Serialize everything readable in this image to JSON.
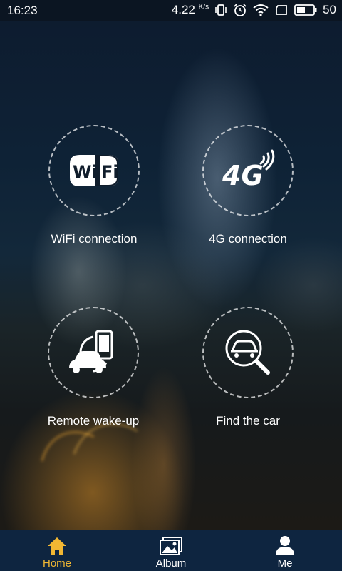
{
  "status_bar": {
    "time": "16:23",
    "network_speed": "4.22",
    "network_speed_unit": "K/s",
    "battery_level": "50",
    "icons": [
      "vibrate-icon",
      "alarm-icon",
      "wifi-signal-icon",
      "sim-icon",
      "battery-icon"
    ]
  },
  "features": [
    {
      "label": "WiFi connection",
      "icon": "wifi-logo-icon"
    },
    {
      "label": "4G connection",
      "icon": "4g-signal-icon"
    },
    {
      "label": "Remote wake-up",
      "icon": "car-phone-sync-icon"
    },
    {
      "label": "Find the car",
      "icon": "car-search-icon"
    }
  ],
  "wifi_logo_text": "WiFi",
  "fourg_logo_text": "4G",
  "bottom_nav": {
    "items": [
      {
        "label": "Home",
        "icon": "home-icon",
        "active": true
      },
      {
        "label": "Album",
        "icon": "album-icon",
        "active": false
      },
      {
        "label": "Me",
        "icon": "person-icon",
        "active": false
      }
    ],
    "active_color": "#f1b733",
    "background": "#0e2540"
  }
}
